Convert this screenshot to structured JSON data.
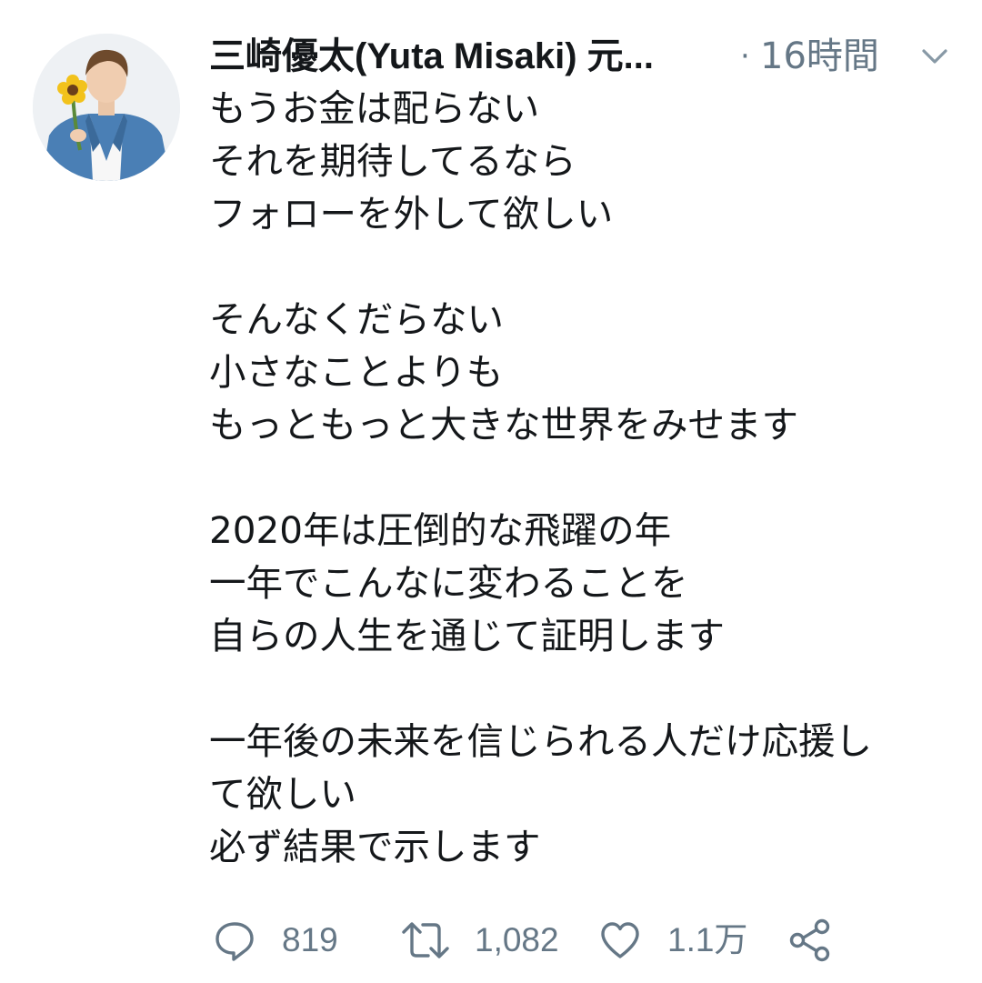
{
  "tweet": {
    "author": {
      "display_name": "三崎優太(Yuta Misaki) 元...",
      "avatar_icon": "profile-photo-man-with-sunflower"
    },
    "separator": "·",
    "timestamp": "16時間",
    "menu_icon": "chevron-down-icon",
    "lines": [
      "もうお金は配らない",
      "それを期待してるなら",
      "フォローを外して欲しい",
      "",
      "そんなくだらない",
      "小さなことよりも",
      "もっともっと大きな世界をみせます",
      "",
      "2020年は圧倒的な飛躍の年",
      "一年でこんなに変わることを",
      "自らの人生を通じて証明します",
      "",
      "一年後の未来を信じられる人だけ応援し",
      "て欲しい",
      "必ず結果で示します"
    ],
    "actions": {
      "reply": {
        "icon": "reply-bubble-icon",
        "count": "819"
      },
      "retweet": {
        "icon": "retweet-icon",
        "count": "1,082"
      },
      "like": {
        "icon": "heart-icon",
        "count": "1.1万"
      },
      "share": {
        "icon": "share-icon"
      }
    }
  },
  "colors": {
    "text": "#14171a",
    "secondary": "#657786",
    "background": "#ffffff",
    "avatar_bg": "#e9eef2",
    "jacket": "#4a7fb5",
    "sunflower": "#f2c21b"
  }
}
